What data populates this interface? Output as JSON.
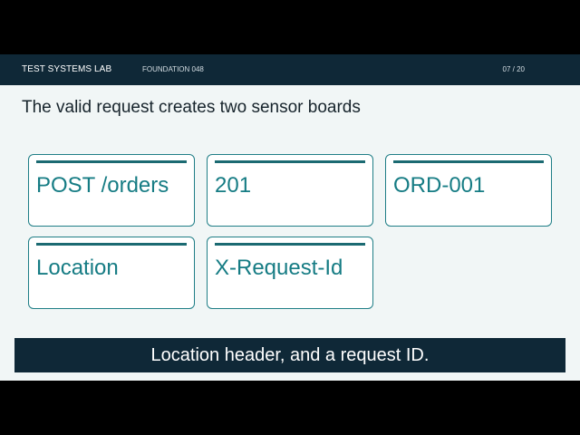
{
  "header": {
    "brand": "TEST SYSTEMS LAB",
    "section": "FOUNDATION 048",
    "page": "07 / 20"
  },
  "slide": {
    "title": "The valid request creates two sensor boards",
    "cards": [
      {
        "label": "POST /orders"
      },
      {
        "label": "201"
      },
      {
        "label": "ORD-001"
      },
      {
        "label": "Location"
      },
      {
        "label": "X-Request-Id"
      }
    ]
  },
  "caption": {
    "text": "Location header, and a request ID."
  },
  "colors": {
    "header_bg": "#0f2837",
    "accent": "#167c84",
    "slide_bg": "#f1f6f6"
  }
}
